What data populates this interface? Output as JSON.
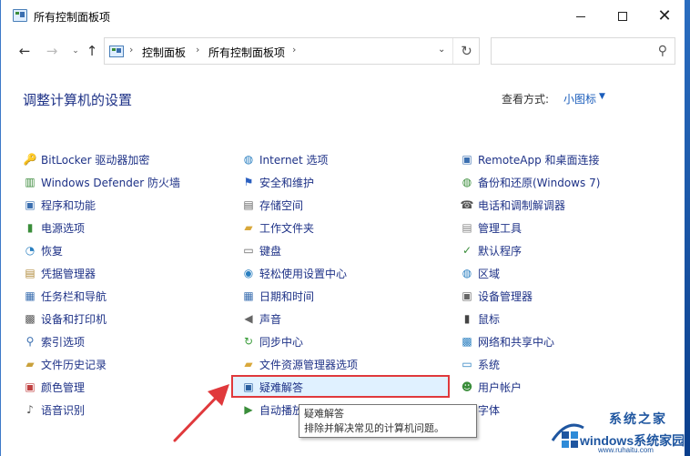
{
  "window": {
    "title": "所有控制面板项",
    "minimize_icon": "minimize-icon",
    "maximize_icon": "maximize-icon",
    "close_glyph": "✕"
  },
  "nav": {
    "back": "←",
    "forward": "→",
    "history": "⌄",
    "up": "↑",
    "breadcrumb": [
      "控制面板",
      "所有控制面板项"
    ],
    "sep": "›",
    "refresh": "↻",
    "search_placeholder": "",
    "search_glyph": "⚲"
  },
  "header": {
    "title": "调整计算机的设置",
    "view_label": "查看方式:",
    "view_value": "小图标",
    "view_caret": "▼"
  },
  "columns": [
    [
      {
        "label": "BitLocker 驱动器加密",
        "icon": "bitlocker-icon"
      },
      {
        "label": "Windows Defender 防火墙",
        "icon": "firewall-icon"
      },
      {
        "label": "程序和功能",
        "icon": "programs-icon"
      },
      {
        "label": "电源选项",
        "icon": "power-icon"
      },
      {
        "label": "恢复",
        "icon": "recovery-icon"
      },
      {
        "label": "凭据管理器",
        "icon": "credential-icon"
      },
      {
        "label": "任务栏和导航",
        "icon": "taskbar-icon"
      },
      {
        "label": "设备和打印机",
        "icon": "printer-icon"
      },
      {
        "label": "索引选项",
        "icon": "indexing-icon"
      },
      {
        "label": "文件历史记录",
        "icon": "file-history-icon"
      },
      {
        "label": "颜色管理",
        "icon": "color-icon"
      },
      {
        "label": "语音识别",
        "icon": "microphone-icon"
      }
    ],
    [
      {
        "label": "Internet 选项",
        "icon": "internet-icon"
      },
      {
        "label": "安全和维护",
        "icon": "flag-icon"
      },
      {
        "label": "存储空间",
        "icon": "storage-icon"
      },
      {
        "label": "工作文件夹",
        "icon": "work-folder-icon"
      },
      {
        "label": "键盘",
        "icon": "keyboard-icon"
      },
      {
        "label": "轻松使用设置中心",
        "icon": "ease-of-access-icon"
      },
      {
        "label": "日期和时间",
        "icon": "calendar-icon"
      },
      {
        "label": "声音",
        "icon": "speaker-icon"
      },
      {
        "label": "同步中心",
        "icon": "sync-icon"
      },
      {
        "label": "文件资源管理器选项",
        "icon": "folder-options-icon"
      },
      {
        "label": "疑难解答",
        "icon": "troubleshoot-icon"
      },
      {
        "label": "自动播放",
        "icon": "autoplay-icon"
      }
    ],
    [
      {
        "label": "RemoteApp 和桌面连接",
        "icon": "remoteapp-icon"
      },
      {
        "label": "备份和还原(Windows 7)",
        "icon": "backup-icon"
      },
      {
        "label": "电话和调制解调器",
        "icon": "phone-icon"
      },
      {
        "label": "管理工具",
        "icon": "admin-tools-icon"
      },
      {
        "label": "默认程序",
        "icon": "default-programs-icon"
      },
      {
        "label": "区域",
        "icon": "region-icon"
      },
      {
        "label": "设备管理器",
        "icon": "device-manager-icon"
      },
      {
        "label": "鼠标",
        "icon": "mouse-icon"
      },
      {
        "label": "网络和共享中心",
        "icon": "network-icon"
      },
      {
        "label": "系统",
        "icon": "system-icon"
      },
      {
        "label": "用户帐户",
        "icon": "user-accounts-icon"
      },
      {
        "label": "字体",
        "icon": "font-icon"
      }
    ]
  ],
  "tooltip": {
    "title": "疑难解答",
    "desc": "排除并解决常见的计算机问题。"
  },
  "watermark": {
    "top": "系统之家",
    "brand": "windows系统家园",
    "url": "www.ruhaitu.com"
  },
  "colors": {
    "link": "#1e3287",
    "highlight_border": "#e0393c",
    "arrow": "#e0393c"
  }
}
